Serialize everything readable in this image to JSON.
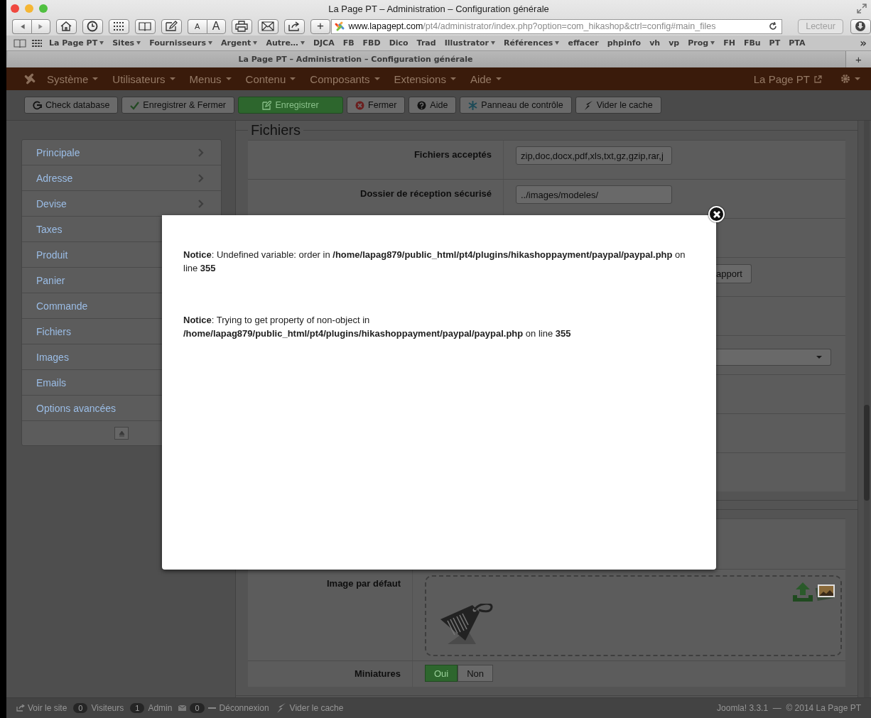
{
  "window": {
    "title": "La Page PT – Administration – Configuration générale"
  },
  "browser": {
    "font_buttons": [
      "A",
      "A"
    ],
    "add_button": "+",
    "url": {
      "host": "www.lapagept.com",
      "path": "/pt4/administrator/index.php?option=com_hikashop&ctrl=config#main_files"
    },
    "reader_button": "Lecteur",
    "overflow": "»",
    "new_tab": "+"
  },
  "bookmarks": [
    {
      "label": "La Page PT",
      "menu": true
    },
    {
      "label": "Sites",
      "menu": true
    },
    {
      "label": "Fournisseurs",
      "menu": true
    },
    {
      "label": "Argent",
      "menu": true
    },
    {
      "label": "Autre…",
      "menu": true
    },
    {
      "label": "DJCA",
      "menu": false
    },
    {
      "label": "FB",
      "menu": false
    },
    {
      "label": "FBD",
      "menu": false
    },
    {
      "label": "Dico",
      "menu": false
    },
    {
      "label": "Trad",
      "menu": false
    },
    {
      "label": "Illustrator",
      "menu": true
    },
    {
      "label": "Références",
      "menu": true
    },
    {
      "label": "effacer",
      "menu": false
    },
    {
      "label": "phpinfo",
      "menu": false
    },
    {
      "label": "vh",
      "menu": false
    },
    {
      "label": "vp",
      "menu": false
    },
    {
      "label": "Prog",
      "menu": true
    },
    {
      "label": "FH",
      "menu": false
    },
    {
      "label": "FBu",
      "menu": false
    },
    {
      "label": "PT",
      "menu": false
    },
    {
      "label": "PTA",
      "menu": false
    }
  ],
  "tab": {
    "title": "La Page PT – Administration – Configuration générale"
  },
  "admin_menu": [
    {
      "label": "Système"
    },
    {
      "label": "Utilisateurs"
    },
    {
      "label": "Menus"
    },
    {
      "label": "Contenu"
    },
    {
      "label": "Composants"
    },
    {
      "label": "Extensions"
    },
    {
      "label": "Aide"
    }
  ],
  "site_link": "La Page PT",
  "toolbar": [
    {
      "label": "Check database",
      "kind": "default"
    },
    {
      "label": "Enregistrer & Fermer",
      "kind": "default"
    },
    {
      "label": "Enregistrer",
      "kind": "primary"
    },
    {
      "label": "Fermer",
      "kind": "default"
    },
    {
      "label": "Aide",
      "kind": "default"
    },
    {
      "label": "Panneau de contrôle",
      "kind": "default"
    },
    {
      "label": "Vider le cache",
      "kind": "default"
    }
  ],
  "sidebar": {
    "items": [
      {
        "label": "Principale",
        "chevron": true
      },
      {
        "label": "Adresse",
        "chevron": true
      },
      {
        "label": "Devise",
        "chevron": true
      },
      {
        "label": "Taxes"
      },
      {
        "label": "Produit"
      },
      {
        "label": "Panier"
      },
      {
        "label": "Commande"
      },
      {
        "label": "Fichiers"
      },
      {
        "label": "Images"
      },
      {
        "label": "Emails"
      },
      {
        "label": "Options avancées"
      }
    ]
  },
  "sections": [
    {
      "legend": "Fichiers",
      "rows": [
        {
          "kind": "input",
          "label": "Fichiers acceptés",
          "value": "zip,doc,docx,pdf,xls,txt,gz,gzip,rar,j"
        },
        {
          "kind": "input",
          "label": "Dossier de réception sécurisé",
          "value": "../images/modeles/"
        },
        {
          "kind": "blank"
        },
        {
          "kind": "button",
          "value": "apport"
        },
        {
          "kind": "blank"
        },
        {
          "kind": "select"
        },
        {
          "kind": "blank"
        },
        {
          "kind": "blank"
        },
        {
          "kind": "blank"
        }
      ]
    },
    {
      "rows": [
        {
          "kind": "blank"
        },
        {
          "kind": "image",
          "label": "Image par défaut"
        },
        {
          "kind": "toggle",
          "label": "Miniatures",
          "options": [
            {
              "label": "Oui",
              "selected": true
            },
            {
              "label": "Non",
              "selected": false
            }
          ]
        }
      ]
    }
  ],
  "modal": {
    "notices": [
      "**Notice**: Undefined variable: order in **/home/lapag879/public_html/pt4/plugins/hikashoppayment/paypal/paypal.php** on line **355**",
      "**Notice**: Trying to get property of non-object in **/home/lapag879/public_html/pt4/plugins/hikashoppayment/paypal/paypal.php** on line **355**"
    ]
  },
  "footer": {
    "view_site": "Voir le site",
    "visitors_count": "0",
    "visitors": "Visiteurs",
    "admin_count": "1",
    "admin": "Admin",
    "messages_count": "0",
    "logout": "Déconnexion",
    "clear_cache": "Vider le cache",
    "credits": "Joomla! 3.3.1  —  © 2014 La Page PT"
  }
}
